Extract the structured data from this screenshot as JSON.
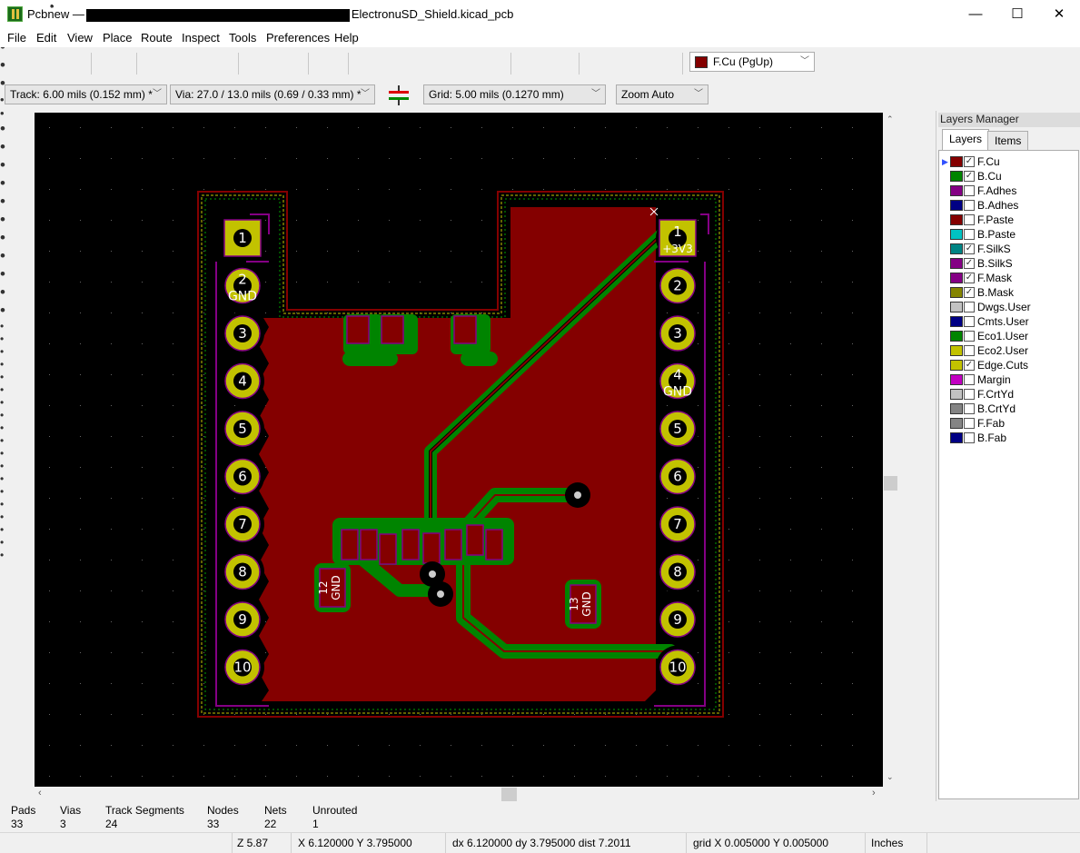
{
  "window": {
    "app": "Pcbnew —",
    "file": "ElectronuSD_Shield.kicad_pcb",
    "minimize": "—",
    "maximize": "☐",
    "close": "✕"
  },
  "menu": [
    {
      "label": "File"
    },
    {
      "label": "Edit"
    },
    {
      "label": "View"
    },
    {
      "label": "Place"
    },
    {
      "label": "Route"
    },
    {
      "label": "Inspect"
    },
    {
      "label": "Tools"
    },
    {
      "label": "Preferences"
    },
    {
      "label": "Help"
    }
  ],
  "toolbar_top": [
    "new-board-icon",
    "open-board-icon",
    "save-icon",
    "board-setup-icon",
    "page-settings-icon",
    "print-icon",
    "plot-icon",
    "undo-icon",
    "redo-icon",
    "find-icon",
    "redraw-icon",
    "zoom-in-icon",
    "zoom-out-icon",
    "zoom-fit-icon",
    "zoom-selection-icon",
    "footprint-editor-icon",
    "footprint-browser-icon",
    "netlist-icon",
    "update-pcb-icon",
    "drc-icon"
  ],
  "layer_select": {
    "value": "F.Cu (PgUp)",
    "color": "#840000"
  },
  "toolbar_top_right": [
    "layer-pair-icon",
    "schematic-icon",
    "scripting-console-icon"
  ],
  "aux": {
    "track": "Track: 6.00 mils (0.152 mm) *",
    "via": "Via: 27.0 / 13.0 mils (0.69 / 0.33 mm) *",
    "grid": "Grid: 5.00 mils (0.1270 mm)",
    "zoom": "Zoom Auto"
  },
  "left_toolbar": [
    "drc-off-icon",
    "grid-icon",
    "polar-coords-icon",
    "inches-icon",
    "millimeters-icon",
    "cursor-shape-icon",
    "ratsnest-icon",
    "zone-fill-icon",
    "zone-outline-icon",
    "zone-sketch-icon",
    "pad-sketch-icon",
    "via-sketch-icon",
    "track-sketch-icon",
    "clearance-icon",
    "high-contrast-icon",
    "microwave-icon"
  ],
  "right_toolbar": [
    "select-icon",
    "highlight-net-icon",
    "local-ratsnest-icon",
    "add-footprint-icon",
    "route-track-icon",
    "add-via-icon",
    "net-inspector-icon",
    "keepout-icon",
    "add-line-icon",
    "add-circle-icon",
    "add-arc-icon",
    "add-polygon-icon",
    "add-text-icon",
    "add-dimension-icon",
    "target-icon",
    "delete-icon",
    "place-origin-icon",
    "grid-origin-icon",
    "measure-icon"
  ],
  "layers_manager": {
    "title": "Layers Manager",
    "tabs": [
      "Layers",
      "Items"
    ],
    "layers": [
      {
        "name": "F.Cu",
        "color": "#840000",
        "visible": true,
        "active": true
      },
      {
        "name": "B.Cu",
        "color": "#008400",
        "visible": true
      },
      {
        "name": "F.Adhes",
        "color": "#840084",
        "visible": false
      },
      {
        "name": "B.Adhes",
        "color": "#000084",
        "visible": false
      },
      {
        "name": "F.Paste",
        "color": "#840000",
        "visible": false
      },
      {
        "name": "B.Paste",
        "color": "#00c2c2",
        "visible": false
      },
      {
        "name": "F.SilkS",
        "color": "#008484",
        "visible": true
      },
      {
        "name": "B.SilkS",
        "color": "#840084",
        "visible": true
      },
      {
        "name": "F.Mask",
        "color": "#840084",
        "visible": true
      },
      {
        "name": "B.Mask",
        "color": "#848400",
        "visible": true
      },
      {
        "name": "Dwgs.User",
        "color": "#c2c2c2",
        "visible": false
      },
      {
        "name": "Cmts.User",
        "color": "#000084",
        "visible": false
      },
      {
        "name": "Eco1.User",
        "color": "#008400",
        "visible": false
      },
      {
        "name": "Eco2.User",
        "color": "#c2c200",
        "visible": false
      },
      {
        "name": "Edge.Cuts",
        "color": "#c2c200",
        "visible": true
      },
      {
        "name": "Margin",
        "color": "#c200c2",
        "visible": false
      },
      {
        "name": "F.CrtYd",
        "color": "#c2c2c2",
        "visible": false
      },
      {
        "name": "B.CrtYd",
        "color": "#848484",
        "visible": false
      },
      {
        "name": "F.Fab",
        "color": "#848484",
        "visible": false
      },
      {
        "name": "B.Fab",
        "color": "#000084",
        "visible": false
      }
    ]
  },
  "pcb": {
    "left_header": [
      {
        "num": "1",
        "net": ""
      },
      {
        "num": "2",
        "net": "GND"
      },
      {
        "num": "3",
        "net": ""
      },
      {
        "num": "4",
        "net": ""
      },
      {
        "num": "5",
        "net": ""
      },
      {
        "num": "6",
        "net": ""
      },
      {
        "num": "7",
        "net": ""
      },
      {
        "num": "8",
        "net": ""
      },
      {
        "num": "9",
        "net": ""
      },
      {
        "num": "10",
        "net": ""
      }
    ],
    "right_header": [
      {
        "num": "1",
        "net": "+3V3"
      },
      {
        "num": "2",
        "net": ""
      },
      {
        "num": "3",
        "net": ""
      },
      {
        "num": "4",
        "net": "GND"
      },
      {
        "num": "5",
        "net": ""
      },
      {
        "num": "6",
        "net": ""
      },
      {
        "num": "7",
        "net": ""
      },
      {
        "num": "8",
        "net": ""
      },
      {
        "num": "9",
        "net": ""
      },
      {
        "num": "10",
        "net": ""
      }
    ],
    "pad12": {
      "num": "12",
      "net": "GND"
    },
    "pad13": {
      "num": "13",
      "net": "GND"
    },
    "colors": {
      "fcu": "#840000",
      "bcu": "#008400",
      "pad": "#c2c200",
      "silk": "#840084",
      "edge": "#c2c200"
    }
  },
  "stats": [
    {
      "label": "Pads",
      "value": "33"
    },
    {
      "label": "Vias",
      "value": "3"
    },
    {
      "label": "Track Segments",
      "value": "24"
    },
    {
      "label": "Nodes",
      "value": "33"
    },
    {
      "label": "Nets",
      "value": "22"
    },
    {
      "label": "Unrouted",
      "value": "1"
    }
  ],
  "status": {
    "zoom": "Z 5.87",
    "pos": "X 6.120000  Y 3.795000",
    "delta": "dx 6.120000  dy 3.795000  dist 7.2011",
    "grid": "grid X 0.005000  Y 0.005000",
    "units": "Inches"
  }
}
